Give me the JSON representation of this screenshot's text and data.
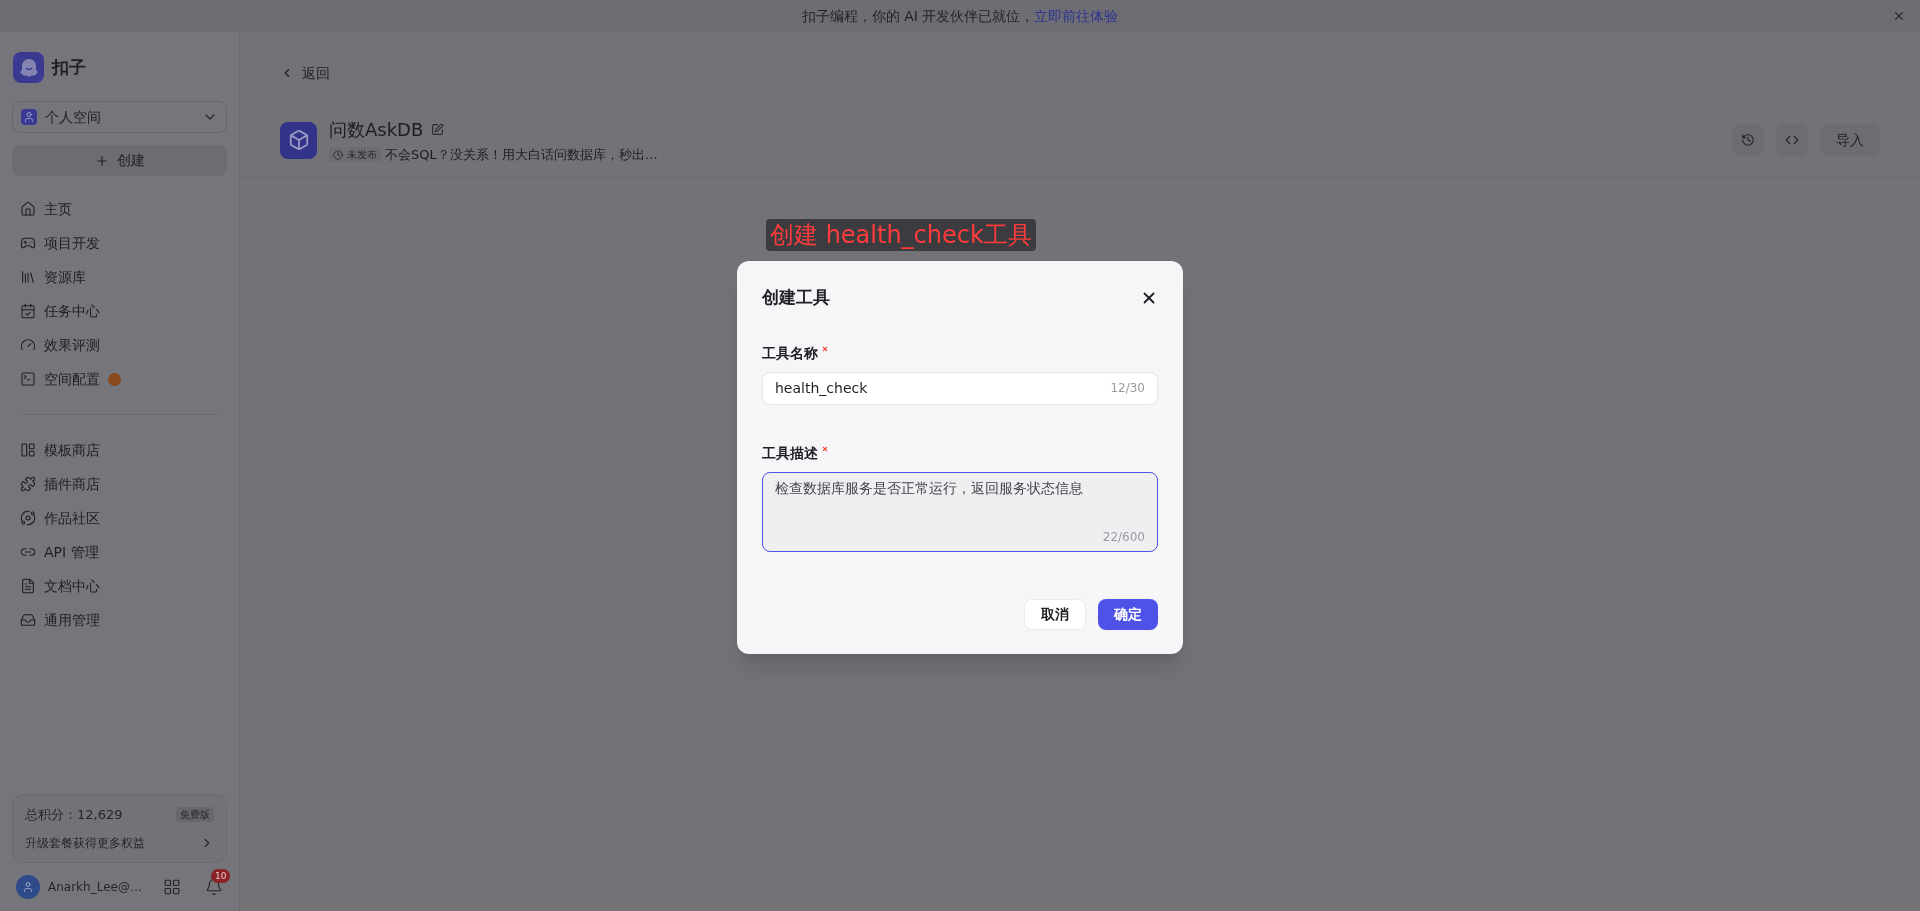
{
  "banner": {
    "text": "扣子编程，你的 AI 开发伙伴已就位，",
    "link": "立即前往体验"
  },
  "app": {
    "name": "扣子"
  },
  "workspace": {
    "label": "个人空间"
  },
  "create_button": {
    "label": "创建"
  },
  "nav_primary": [
    {
      "label": "主页",
      "alert": false
    },
    {
      "label": "项目开发",
      "alert": false
    },
    {
      "label": "资源库",
      "alert": false
    },
    {
      "label": "任务中心",
      "alert": false
    },
    {
      "label": "效果评测",
      "alert": false
    },
    {
      "label": "空间配置",
      "alert": true
    }
  ],
  "nav_secondary": [
    {
      "label": "模板商店"
    },
    {
      "label": "插件商店"
    },
    {
      "label": "作品社区"
    },
    {
      "label": "API 管理"
    },
    {
      "label": "文档中心"
    },
    {
      "label": "通用管理"
    }
  ],
  "points": {
    "label": "总积分：12,629",
    "plan": "免费版",
    "upgrade": "升级套餐获得更多权益"
  },
  "user": {
    "name": "Anarkh_Lee@…",
    "notifications": "10"
  },
  "back": "返回",
  "project": {
    "title": "问数AskDB",
    "status": "未发布",
    "description": "不会SQL？没关系！用大白话问数据库，秒出…"
  },
  "header_actions": {
    "import": "导入"
  },
  "annotation": "创建 health_check工具",
  "dialog": {
    "title": "创建工具",
    "fields": [
      {
        "kind": "input",
        "label": "工具名称",
        "required": true,
        "value": "health_check",
        "counter": "12/30",
        "focused": false
      },
      {
        "kind": "textarea",
        "label": "工具描述",
        "required": true,
        "value": "检查数据库服务是否正常运行，返回服务状态信息",
        "counter": "22/600",
        "focused": true
      }
    ],
    "cancel": "取消",
    "confirm": "确定"
  }
}
